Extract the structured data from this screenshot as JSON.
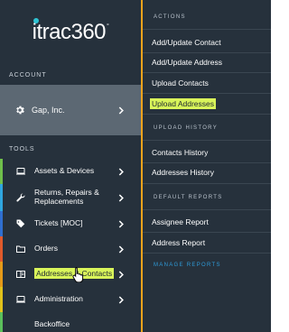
{
  "logo": {
    "text": "itrac360",
    "reg": "°"
  },
  "sidebar": {
    "account_label": "ACCOUNT",
    "account_name": "Gap, Inc.",
    "tools_label": "TOOLS",
    "items": [
      {
        "label": "Assets & Devices",
        "stripe": "#6fbf4b",
        "icon": "laptop-icon"
      },
      {
        "label": "Returns, Repairs & Replacements",
        "stripe": "#2fa6df",
        "icon": "wrench-icon"
      },
      {
        "label": "Tickets [MOC]",
        "stripe": "#2f6fd0",
        "icon": "tag-icon"
      },
      {
        "label": "Orders",
        "stripe": "#e05a2b",
        "icon": "folder-icon"
      },
      {
        "label": "Addresses & Contacts",
        "stripe": "#e59a19",
        "icon": "address-book-icon"
      },
      {
        "label": "Administration",
        "stripe": "#e0c21b",
        "icon": "laptop-icon"
      },
      {
        "label": "Backoffice",
        "stripe": "#5bbf5b",
        "icon": "none"
      }
    ]
  },
  "panel": {
    "actions_label": "ACTIONS",
    "actions": [
      "Add/Update Contact",
      "Add/Update Address",
      "Upload Contacts",
      "Upload Addresses"
    ],
    "upload_history_label": "UPLOAD HISTORY",
    "history": [
      "Contacts History",
      "Addresses History"
    ],
    "default_reports_label": "DEFAULT REPORTS",
    "reports": [
      "Assignee Report",
      "Address Report"
    ],
    "manage_reports_label": "MANAGE REPORTS"
  },
  "colors": {
    "highlight": "#d9f55a",
    "divider": "#f3a31c",
    "manage_link": "#2f9bd9"
  }
}
